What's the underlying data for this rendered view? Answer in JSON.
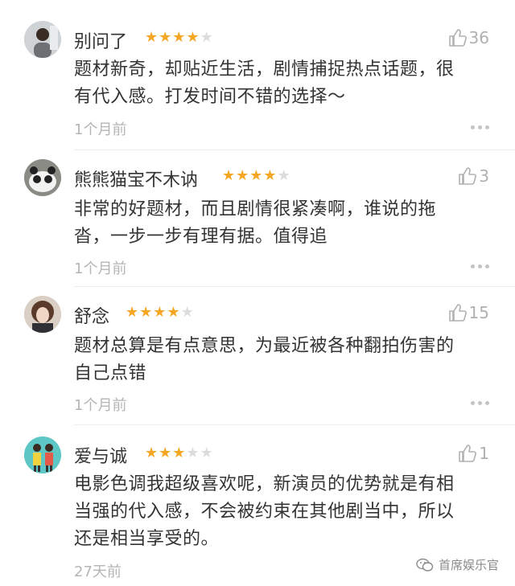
{
  "comments": [
    {
      "username": "别问了",
      "stars_filled": 4,
      "stars_total": 5,
      "likes": "36",
      "text_lines": [
        "题材新奇，却贴近生活，剧情捕捉热点话题，很",
        "有代入感。打发时间不错的选择～"
      ],
      "time": "1个月前"
    },
    {
      "username": "熊熊猫宝不木讷",
      "stars_filled": 4,
      "stars_total": 5,
      "likes": "3",
      "text_lines": [
        "非常的好题材，而且剧情很紧凑啊，谁说的拖",
        "沓，一步一步有理有据。值得追"
      ],
      "time": "1个月前"
    },
    {
      "username": "舒念",
      "stars_filled": 4,
      "stars_total": 5,
      "likes": "15",
      "text_lines": [
        "题材总算是有点意思，为最近被各种翻拍伤害的",
        "自己点错"
      ],
      "time": "1个月前"
    },
    {
      "username": "爱与诚",
      "stars_filled": 3,
      "stars_total": 5,
      "likes": "1",
      "text_lines": [
        "电影色调我超级喜欢呢，新演员的优势就是有相",
        "当强的代入感，不会被约束在其他剧当中，所以",
        "还是相当享受的。"
      ],
      "time": "27天前"
    }
  ],
  "watermark": "首席娱乐官",
  "icons": {
    "like": "thumbs-up-outline-icon",
    "more": "more-dots-icon",
    "watermark": "wechat-icon"
  },
  "colors": {
    "star_on": "#f5a623",
    "star_off": "#dcdcdc",
    "muted": "#b5b5b5"
  }
}
